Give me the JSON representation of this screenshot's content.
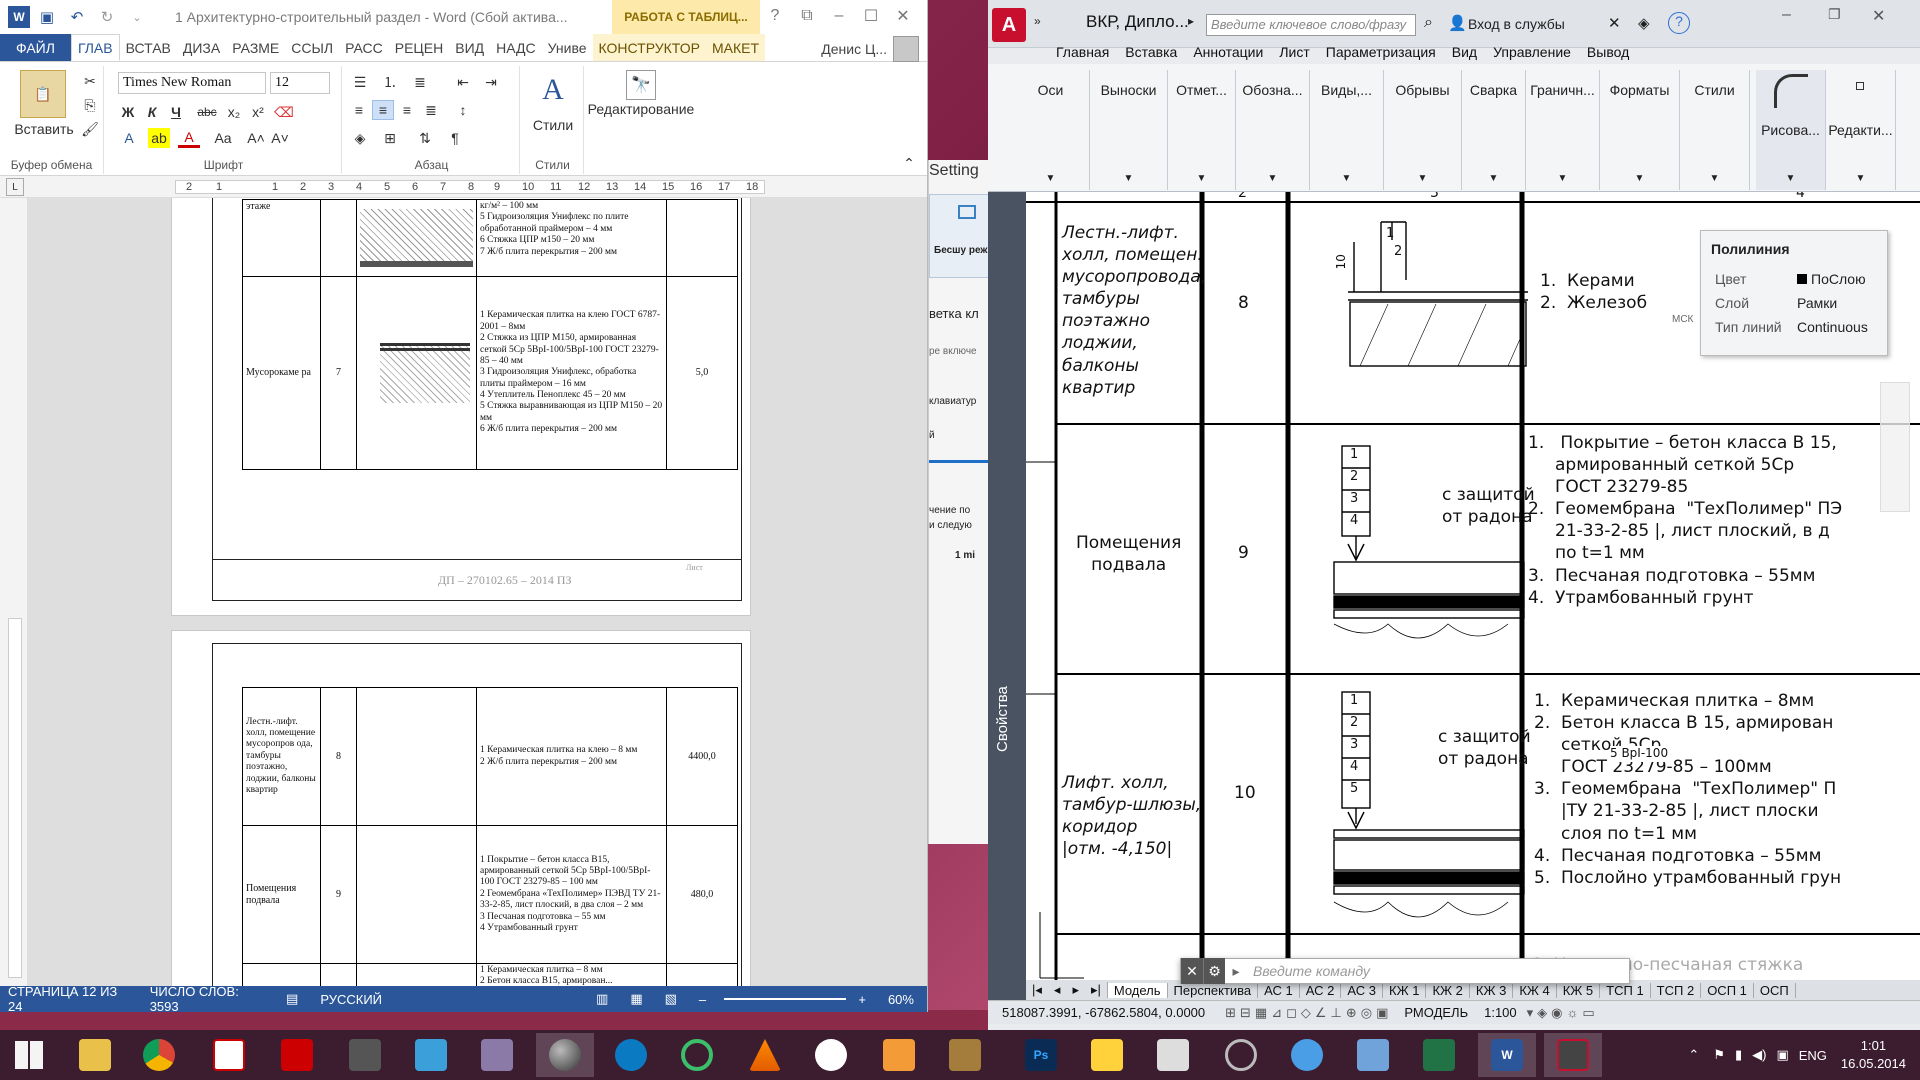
{
  "word": {
    "title": "1 Архитектурно-строительный раздел - Word (Сбой актива...",
    "context_title": "РАБОТА С ТАБЛИЦ...",
    "tabs": [
      "ФАЙЛ",
      "ГЛАВ",
      "ВСТАВ",
      "ДИЗА",
      "РАЗМЕ",
      "ССЫЛ",
      "РАСС",
      "РЕЦЕН",
      "ВИД",
      "НАДС",
      "Униве",
      "КОНСТРУКТОР",
      "МАКЕТ"
    ],
    "user": "Денис Ц...",
    "font_name": "Times New Roman",
    "font_size": "12",
    "paste_label": "Вставить",
    "styles_label": "Стили",
    "edit_label": "Редактирование",
    "group_clipboard": "Буфер обмена",
    "group_font": "Шрифт",
    "group_paragraph": "Абзац",
    "group_styles": "Стили",
    "ruler_numbers": [
      "2",
      "1",
      "1",
      "2",
      "3",
      "4",
      "5",
      "6",
      "7",
      "8",
      "9",
      "10",
      "11",
      "12",
      "13",
      "14",
      "15",
      "16",
      "17",
      "18"
    ],
    "page1": {
      "row_a_label": "этаже",
      "row_a_text": "кг/м² – 100 мм\n5 Гидроизоляция Унифлекс по плите обработанной праймером – 4 мм\n6 Стяжка ЦПР м150 – 20 мм\n7 Ж/б плита перекрытия – 200 мм",
      "row_b_label": "Мусорокаме ра",
      "row_b_num": "7",
      "row_b_text": "1 Керамическая плитка на клею ГОСТ 6787-2001 – 8мм\n2 Стяжка из ЦПР М150, армированная сеткой 5Ср 5ВрI-100/5ВрI-100 ГОСТ 23279-85 – 40 мм\n3 Гидроизоляция Унифлекс, обработка плиты праймером – 16 мм\n4 Утеплитель Пеноплекс 45 – 20 мм\n5 Стяжка выравнивающая из ЦПР М150 – 20 мм\n6 Ж/б плита перекрытия – 200 мм",
      "row_b_area": "5,0",
      "stamp": "ДП – 270102.65 – 2014 ПЗ",
      "sheet": "Лист"
    },
    "page2": {
      "row1_label": "Лестн.-лифт. холл, помещение мусоропров ода, тамбуры поэтажно, лоджии, балконы квартир",
      "row1_num": "8",
      "row1_text": "1 Керамическая плитка на клею – 8 мм\n2 Ж/б плита перекрытия – 200 мм",
      "row1_area": "4400,0",
      "row2_label": "Помещения подвала",
      "row2_num": "9",
      "row2_text": "1 Покрытие – бетон класса В15, армированный сеткой 5Ср 5ВрI-100/5ВрI-100 ГОСТ 23279-85 – 100 мм\n2 Геомембрана «ТехПолимер» ПЭВД ТУ 21-33-2-85, лист плоский, в два слоя – 2 мм\n3 Песчаная подготовка – 55 мм\n4 Утрамбованный грунт",
      "row2_area": "480,0",
      "row3_text": "1 Керамическая плитка – 8 мм\n2 Бетон класса В15, армирован..."
    },
    "status": {
      "page": "СТРАНИЦА 12 ИЗ 24",
      "words": "ЧИСЛО СЛОВ: 3593",
      "lang": "РУССКИЙ",
      "zoom": "60%"
    }
  },
  "middle": {
    "settings": "Setting",
    "free_label": "Бесшу реж",
    "lines": [
      "ветка кл",
      "ре включе",
      "клавиатур",
      "й",
      "чение по",
      "и следую",
      "1 mi"
    ]
  },
  "autocad": {
    "title": "ВКР, Дипло...",
    "search_placeholder": "Введите ключевое слово/фразу",
    "login": "Вход в службы",
    "menu": [
      "Главная",
      "Вставка",
      "Аннотации",
      "Лист",
      "Параметризация",
      "Вид",
      "Управление",
      "Вывод"
    ],
    "ribbon": [
      "Оси",
      "Выноски",
      "Отмет...",
      "Обозна...",
      "Виды,...",
      "Обрывы",
      "Сварка",
      "Граничн...",
      "Форматы",
      "Стили",
      "Рисова...",
      "Редакти..."
    ],
    "props_label": "Свойства",
    "col_headers": [
      "2",
      "3",
      "4"
    ],
    "rows": [
      {
        "label": "Лестн.-лифт.\nхолл, помещен.\nмусоропровода,\nтамбуры\nпоэтажно\nлоджии,\nбалконы\nквартир",
        "num": "8",
        "layers": "1.  Керами\n2.  Железоб"
      },
      {
        "label": "Помещения\nподвала",
        "num": "9",
        "note": "с защитой\nот радона",
        "layers": "1.   Покрытие – бетон класса В 15,\n     армированный сеткой 5Ср\n     ГОСТ 23279-85\n2.  Геомембрана  \"ТехПолимер\" ПЭ\n     21-33-2-85 |, лист плоский, в д\n     по t=1 мм\n3.  Песчаная подготовка – 55мм\n4.  Утрамбованный грунт"
      },
      {
        "label": "Лифт. холл,\nтамбур-шлюзы,\nкоридор\n|отм. -4,150|",
        "num": "10",
        "note": "с защитой\nот радона",
        "layers": "1.  Керамическая плитка – 8мм\n2.  Бетон класса В 15, армирован\n     сеткой 5Ср\n     ГОСТ 23279-85 – 100мм\n3.  Геомембрана  \"ТехПолимер\" П\n     |ТУ 21-33-2-85 |, лист плоски\n     слоя по t=1 мм\n4.  Песчаная подготовка – 55мм\n5.  Послойно утрамбованный грун"
      }
    ],
    "leader_nums": [
      "1",
      "2",
      "3",
      "4",
      "5"
    ],
    "dim_10": "10",
    "mesh_label": "5 ВрI-100",
    "tooltip": {
      "title": "Полилиния",
      "rows": [
        [
          "Цвет",
          "ПоСлою"
        ],
        [
          "Слой",
          "Рамки"
        ],
        [
          "Тип линий",
          "Continuous"
        ]
      ]
    },
    "msk": "МСК",
    "cmd_placeholder": "Введите команду",
    "next_row": "1.  Цементно-песчаная стяжка",
    "layout_tabs": [
      "Модель",
      "Перспектива",
      "АС 1",
      "АС 2",
      "АС 3",
      "КЖ 1",
      "КЖ 2",
      "КЖ 3",
      "КЖ 4",
      "КЖ 5",
      "ТСП 1",
      "ТСП 2",
      "ОСП 1",
      "ОСП"
    ],
    "coords": "518087.3991, -67862.5804, 0.0000",
    "model_label": "РМОДЕЛЬ",
    "scale": "1:100"
  },
  "taskbar": {
    "lang": "ENG",
    "time": "1:01",
    "date": "16.05.2014"
  },
  "colors": {
    "word_blue": "#2b579a",
    "acad_red": "#c8102e",
    "taskbar": "#3c1d30"
  }
}
